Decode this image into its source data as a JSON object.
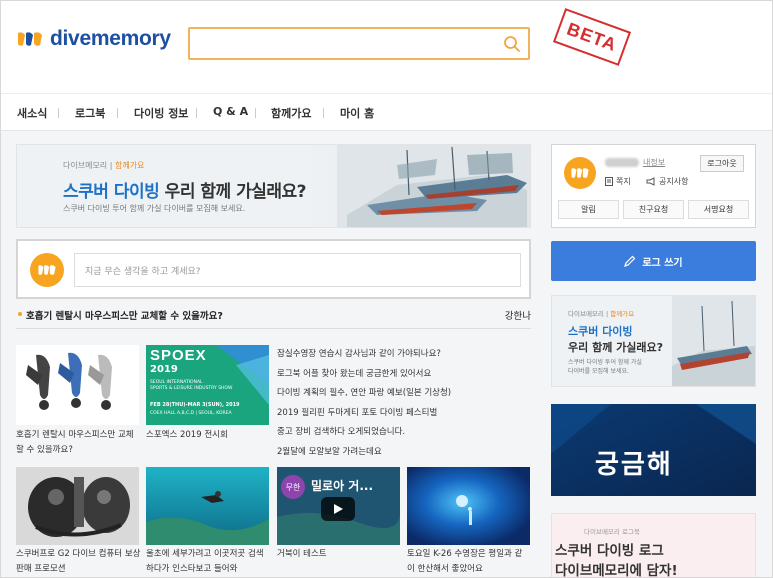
{
  "header": {
    "logo_text": "divememory",
    "search_placeholder": "",
    "beta_stamp": "BETA"
  },
  "nav": {
    "items": [
      "새소식",
      "로그북",
      "다이빙 정보",
      "Q & A",
      "함께가요",
      "마이 홈"
    ]
  },
  "main_banner": {
    "brand": "다이브메모리",
    "tag": "함께가요",
    "title_blue": "스쿠버 다이빙",
    "title_rest": " 우리 함께 가실래요?",
    "subtitle": "스쿠버 다이빙 투어 함께 가실 다이버를 모집해 보세요."
  },
  "post_box": {
    "placeholder": "지금 무슨 생각을 하고 계세요?"
  },
  "headline": {
    "text": "호흡기 렌탈시 마우스피스만 교체할 수 있을까요?",
    "right": "강한나"
  },
  "top_cards": [
    {
      "caption_lines": [
        "호흡기 렌탈시 마우스피스만 교체",
        "할 수 있을까요?"
      ]
    },
    {
      "caption_lines": [
        "스포엑스 2019 전시회"
      ],
      "poster": {
        "logo": "SPOEX",
        "year": "2019",
        "line1": "SEOUL INTERNATIONAL",
        "line2": "SPORTS & LEISURE INDUSTRY SHOW",
        "date": "FEB 28(THU)-MAR 3(SUN), 2019",
        "venue": "COEX HALL A,B,C,D | SEOUL, KOREA"
      }
    }
  ],
  "news_list": [
    "잠실수영장 연습시 감사님과 같이 가야되나요?",
    "로그북 어플 찾아 왔는데 궁금한게 있어서요",
    "다이빙 계획의 필수, 연안 파랑 예보(일본 기상청)",
    "2019 필리핀 두마게티 포토 다이빙 페스티벌",
    "중고 장비 검색하다 오게되었습니다.",
    "2월달에 모알보알 가려는데요"
  ],
  "bottom_cards": [
    {
      "caption_lines": [
        "스쿠버프로 G2 다이브 컴퓨터 보상",
        "판매 프로모션"
      ]
    },
    {
      "caption_lines": [
        "울초에 세부가려고 이곳저곳 검색",
        "하다가 인스타보고 들어와"
      ]
    },
    {
      "caption_lines": [
        "거북이 테스트"
      ],
      "badge": "무한",
      "overlay": "밀로아 거..."
    },
    {
      "caption_lines": [
        "토요일 K-26 수영장은 평일과 같",
        "이 한산해서 좋았어요"
      ]
    }
  ],
  "profile": {
    "my_info": "내정보",
    "logout": "로그아웃",
    "note": "쪽지",
    "notice": "공지사항",
    "tabs": [
      "알림",
      "친구요청",
      "서명요청"
    ]
  },
  "write_button": "로그 쓰기",
  "side_banners": {
    "first": {
      "brand": "다이브메모리",
      "tag": "함께가요",
      "title_blue": "스쿠버 다이빙",
      "title_rest": "우리 함께 가실래요?",
      "sub1": "스쿠버 다이빙 투어 함께 가실",
      "sub2": "다이버를 모집해 보세요."
    },
    "second": {
      "text": "궁금해"
    },
    "third": {
      "brand": "다이브메모리 로그북",
      "line1": "스쿠버 다이빙 로그",
      "line2": "다이브메모리에 담자!"
    }
  },
  "colors": {
    "brand_blue": "#1d4fa2",
    "accent_orange": "#f7a521",
    "write_button": "#3b7ddd",
    "stamp_red": "#d62d2d"
  }
}
